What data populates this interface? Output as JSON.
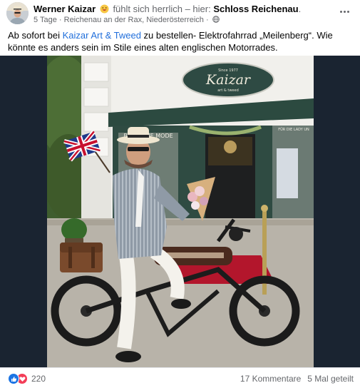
{
  "post": {
    "author": "Werner Kaizar",
    "feeling_text": "fühlt sich herrlich – hier:",
    "location_name": "Schloss Reichenau",
    "location_suffix": ".",
    "time_ago": "5 Tage",
    "separator": "·",
    "place_detail": "Reichenau an der Rax, Niederösterreich",
    "separator2": "·",
    "text_before_link": "Ab sofort bei ",
    "link_text": "Kaizar Art & Tweed",
    "text_after_link": " zu bestellen- Elektrofahrrad „Meilenberg“. Wie könnte es anders sein im Stile eines alten englischen Motorrades."
  },
  "photo": {
    "shop_sign": "Kaizar",
    "shop_sign_sub": "art & tweed",
    "shop_sign_top": "Since 1977",
    "window_left_text": "BRITISCHE MODE",
    "window_right_text": "FÜR DIE LADY UN"
  },
  "footer": {
    "reaction_count": "220",
    "comments": "17 Kommentare",
    "shares": "5 Mal geteilt"
  },
  "colors": {
    "link": "#216fdb",
    "secondary_text": "#65676b",
    "like_blue": "#1b74e4",
    "love_red": "#f33e58",
    "photo_frame": "#1a2431",
    "shop_green": "#2e4a43"
  },
  "icons": {
    "avatar": "avatar",
    "feeling": "grinning-emoji-icon",
    "privacy": "globe-icon",
    "more": "more-options-icon",
    "like": "like-reaction-icon",
    "love": "love-reaction-icon"
  }
}
